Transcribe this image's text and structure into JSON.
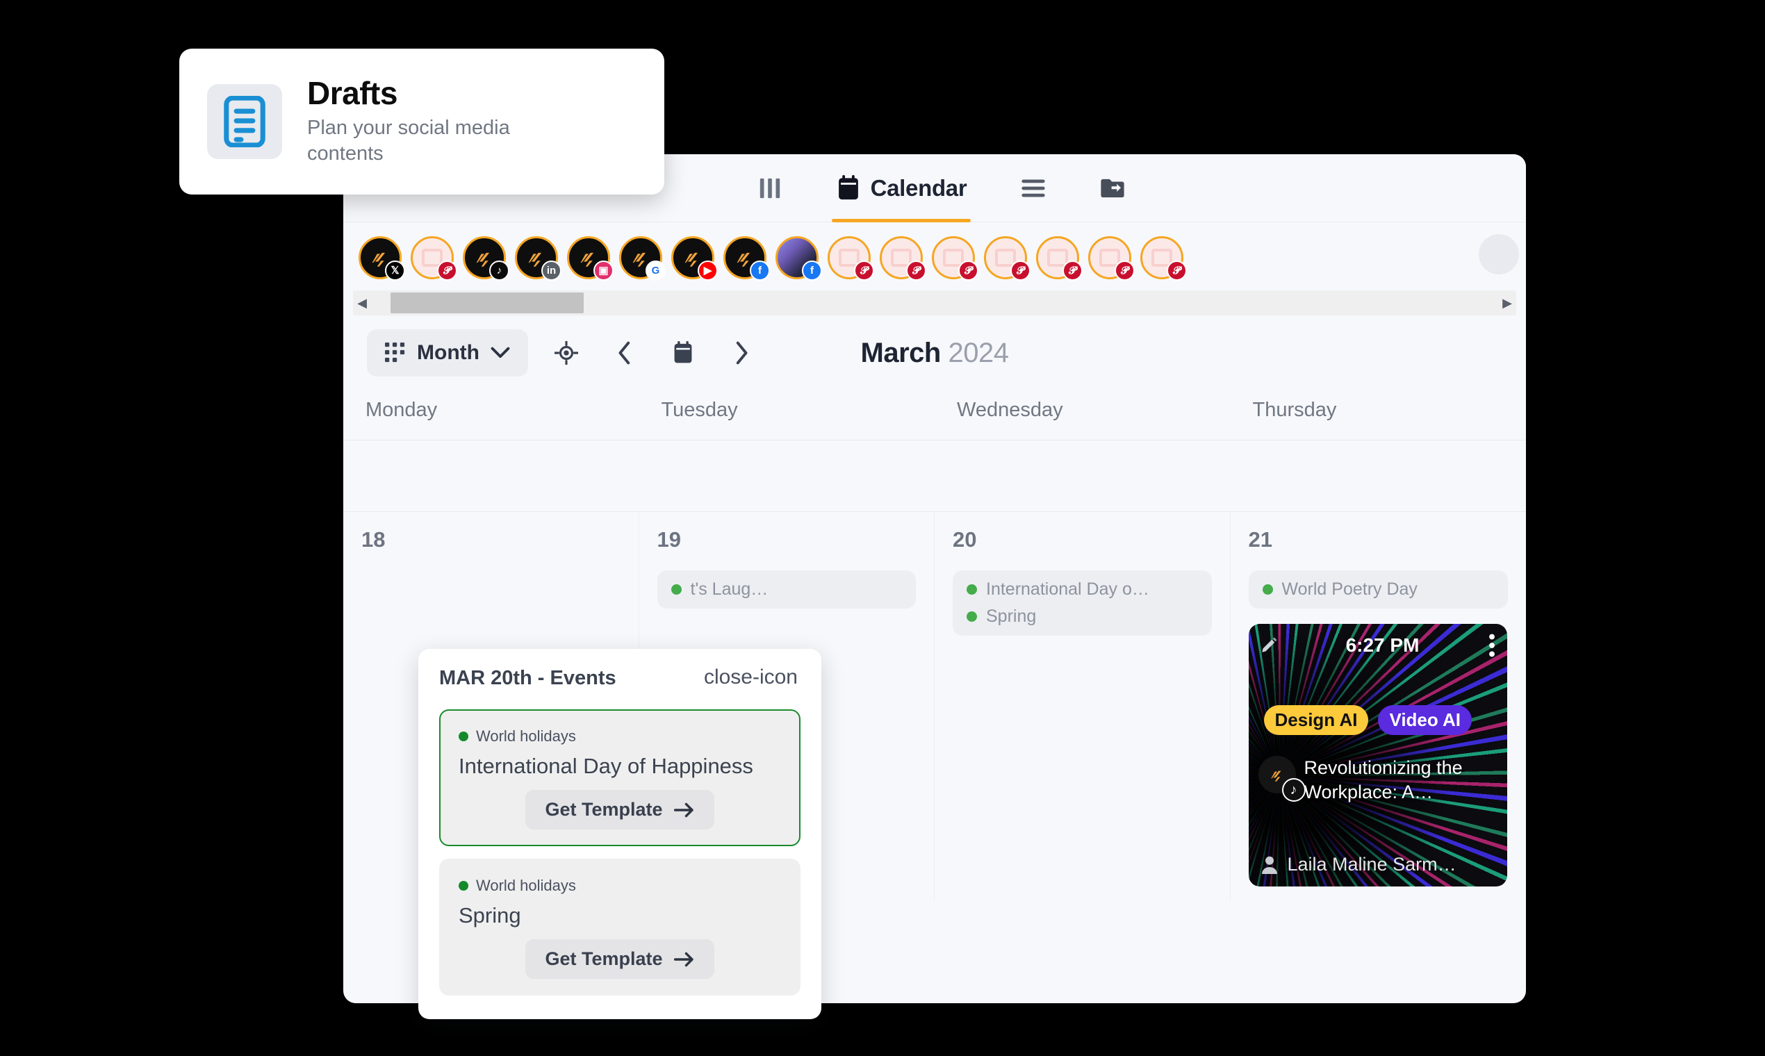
{
  "drafts_card": {
    "icon": "document-lines-icon",
    "title": "Drafts",
    "subtitle": "Plan your social media contents"
  },
  "topnav": {
    "items": [
      {
        "icon": "columns-icon",
        "label": "",
        "active": false
      },
      {
        "icon": "calendar-icon",
        "label": "Calendar",
        "active": true
      },
      {
        "icon": "list-lines-icon",
        "label": "",
        "active": false
      },
      {
        "icon": "folder-share-icon",
        "label": "",
        "active": false
      }
    ],
    "active_underline_color": "#f5a623"
  },
  "avatar_strip": {
    "ring_color": "#f5a623",
    "accounts": [
      {
        "type": "logo",
        "platform": "x"
      },
      {
        "type": "empty",
        "platform": "pinterest"
      },
      {
        "type": "logo",
        "platform": "tiktok"
      },
      {
        "type": "logo",
        "platform": "linkedin"
      },
      {
        "type": "logo",
        "platform": "instagram"
      },
      {
        "type": "logo",
        "platform": "google"
      },
      {
        "type": "logo",
        "platform": "youtube"
      },
      {
        "type": "logo",
        "platform": "facebook"
      },
      {
        "type": "photo",
        "platform": "facebook"
      },
      {
        "type": "empty",
        "platform": "pinterest"
      },
      {
        "type": "empty",
        "platform": "pinterest"
      },
      {
        "type": "empty",
        "platform": "pinterest"
      },
      {
        "type": "empty",
        "platform": "pinterest"
      },
      {
        "type": "empty",
        "platform": "pinterest"
      },
      {
        "type": "empty",
        "platform": "pinterest"
      },
      {
        "type": "empty",
        "platform": "pinterest"
      }
    ],
    "scrollbar": {
      "left_arrow": "◀",
      "right_arrow": "▶"
    }
  },
  "toolbar": {
    "view_label": "Month",
    "view_icon": "grid-icon",
    "chevron": "chevron-down-icon",
    "today_icon": "target-icon",
    "prev_icon": "chevron-left-icon",
    "calendar_icon": "calendar-icon",
    "next_icon": "chevron-right-icon"
  },
  "calendar": {
    "month": "March",
    "year": "2024",
    "weekdays": [
      "Monday",
      "Tuesday",
      "Wednesday",
      "Thursday"
    ],
    "days": [
      {
        "num": "18",
        "events": []
      },
      {
        "num": "19",
        "events": [
          {
            "label": "t's Laug…",
            "color": "#44ac4a"
          }
        ]
      },
      {
        "num": "20",
        "events": [
          {
            "label": "International Day o…",
            "color": "#44ac4a"
          },
          {
            "label": "Spring",
            "color": "#44ac4a"
          }
        ]
      },
      {
        "num": "21",
        "events": [
          {
            "label": "World Poetry Day",
            "color": "#44ac4a"
          }
        ]
      }
    ]
  },
  "post_card": {
    "time": "6:27 PM",
    "edit_icon": "pencil-icon",
    "menu_icon": "kebab-menu-icon",
    "tags": [
      {
        "label": "Design AI",
        "bg": "#fcca3b",
        "fg": "#121212"
      },
      {
        "label": "Video AI",
        "bg": "#5a2bdf",
        "fg": "#ffffff"
      }
    ],
    "platform": "tiktok",
    "title": "Revolutionizing the Workplace: A…",
    "author": "Laila Maline Sarm…",
    "author_icon": "person-icon"
  },
  "events_popover": {
    "title": "MAR 20th - Events",
    "close_icon": "close-icon",
    "events": [
      {
        "category": "World holidays",
        "name": "International Day of Happiness",
        "button": "Get Template",
        "button_icon": "arrow-right-icon",
        "selected": true,
        "dot_color": "#148a2b"
      },
      {
        "category": "World holidays",
        "name": "Spring",
        "button": "Get Template",
        "button_icon": "arrow-right-icon",
        "selected": false,
        "dot_color": "#148a2b"
      }
    ]
  }
}
